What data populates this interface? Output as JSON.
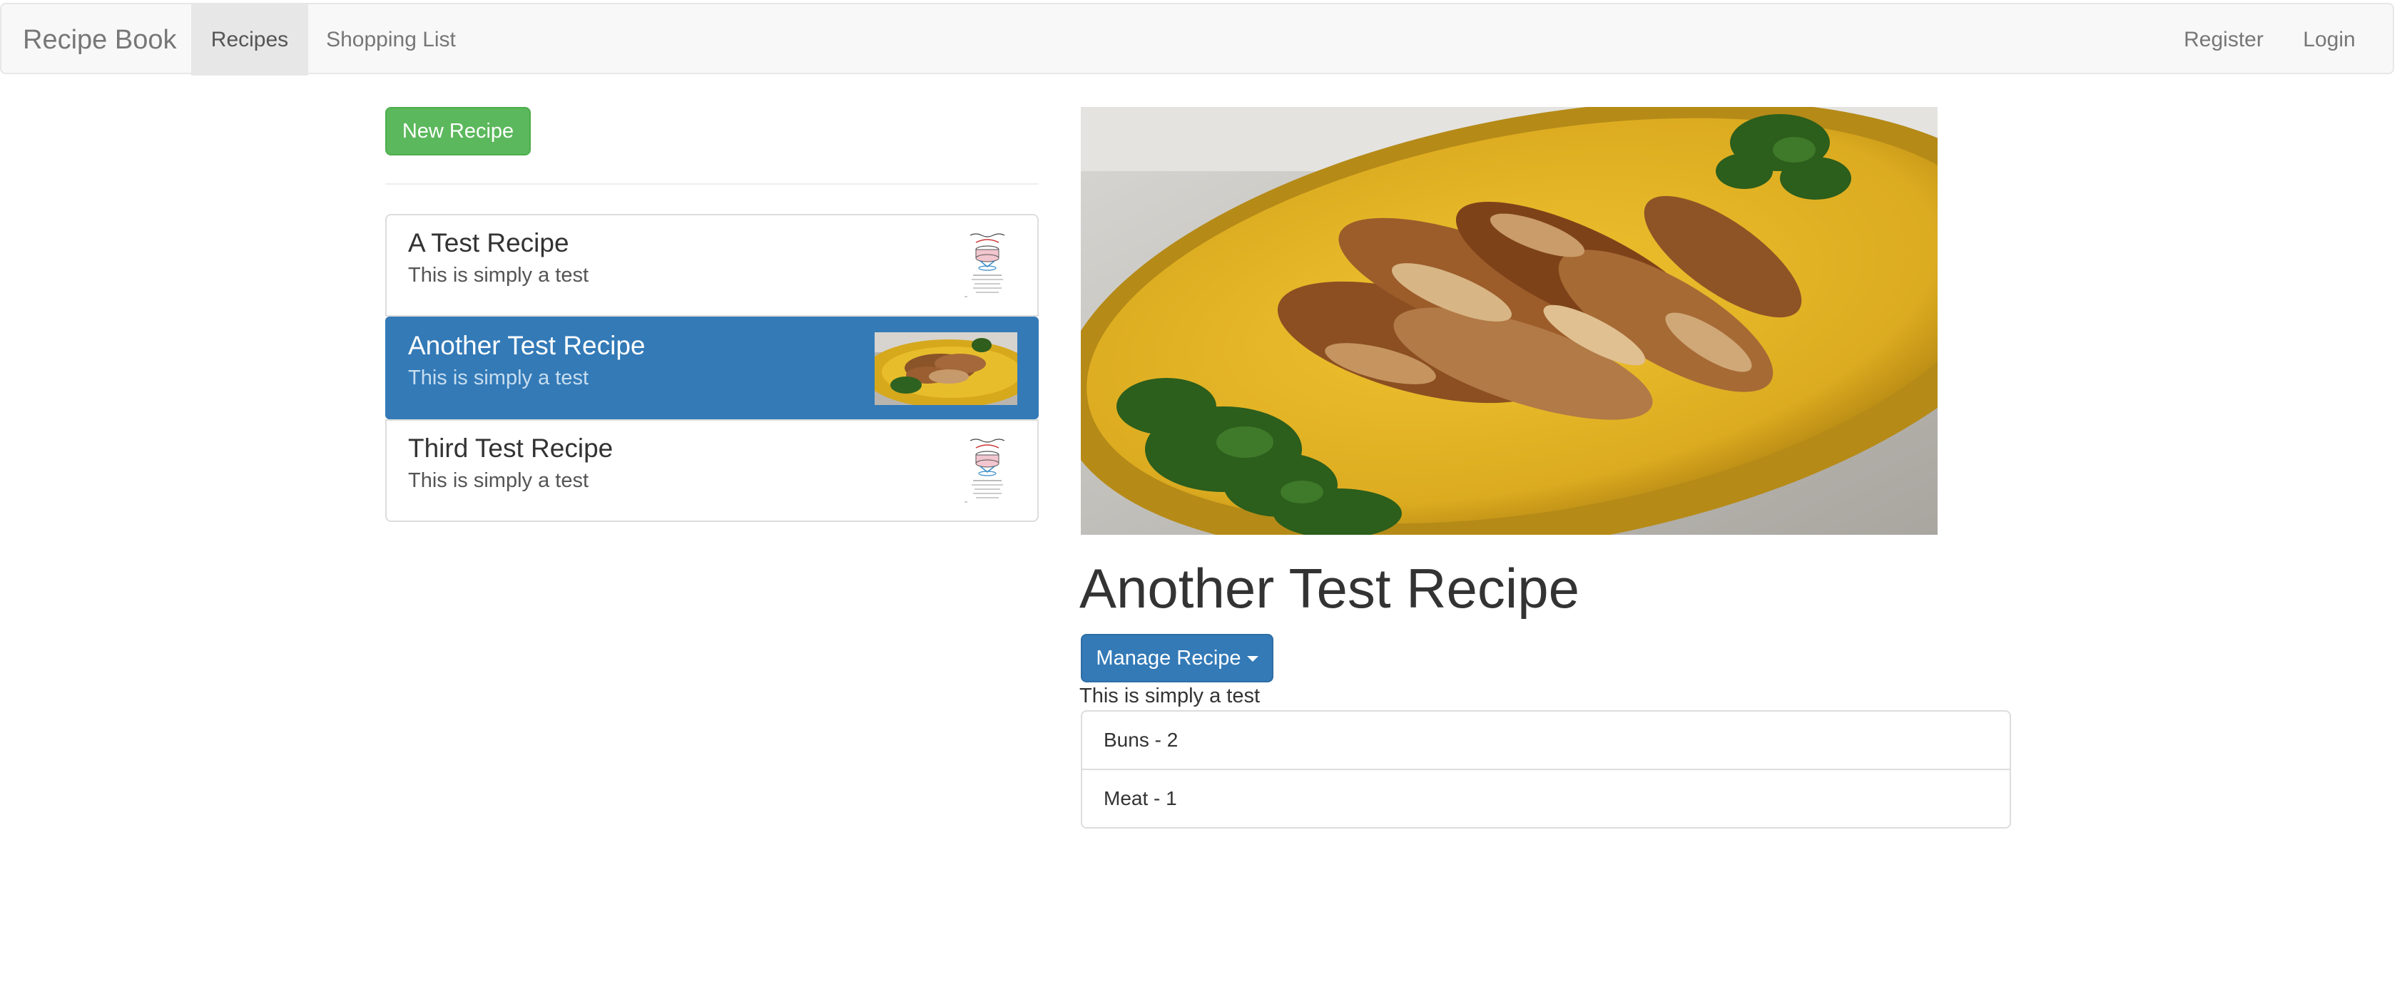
{
  "navbar": {
    "brand": "Recipe Book",
    "links": {
      "recipes": "Recipes",
      "shopping_list": "Shopping List",
      "register": "Register",
      "login": "Login"
    }
  },
  "left": {
    "new_recipe_label": "New Recipe",
    "recipes": [
      {
        "title": "A Test Recipe",
        "description": "This is simply a test",
        "thumbnail": "cake-sketch-image",
        "active": false
      },
      {
        "title": "Another Test Recipe",
        "description": "This is simply a test",
        "thumbnail": "chicken-dish-image",
        "active": true
      },
      {
        "title": "Third Test Recipe",
        "description": "This is simply a test",
        "thumbnail": "cake-sketch-image",
        "active": false
      }
    ]
  },
  "detail": {
    "image": "chicken-dish-image",
    "title": "Another Test Recipe",
    "manage_label": "Manage Recipe",
    "description": "This is simply a test",
    "ingredients": [
      "Buns - 2",
      "Meat - 1"
    ]
  },
  "colors": {
    "primary": "#337ab7",
    "success": "#5cb85c",
    "navbar_bg": "#f8f8f8"
  }
}
